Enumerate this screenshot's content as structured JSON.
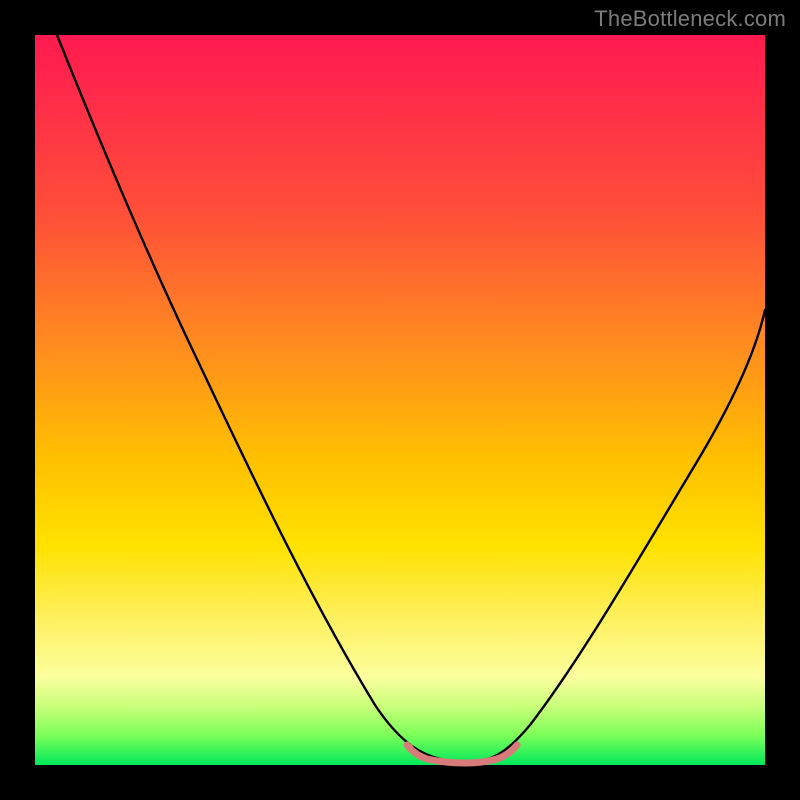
{
  "watermark": "TheBottleneck.com",
  "chart_data": {
    "type": "line",
    "title": "",
    "xlabel": "",
    "ylabel": "",
    "xlim": [
      0,
      100
    ],
    "ylim": [
      0,
      100
    ],
    "grid": false,
    "legend": false,
    "gradient_stops": [
      {
        "pos": 0,
        "color": "#ff1a4f"
      },
      {
        "pos": 25,
        "color": "#ff5038"
      },
      {
        "pos": 50,
        "color": "#ffb010"
      },
      {
        "pos": 75,
        "color": "#fff060"
      },
      {
        "pos": 92,
        "color": "#c8ff7a"
      },
      {
        "pos": 100,
        "color": "#00e85a"
      }
    ],
    "series": [
      {
        "name": "bottleneck-curve",
        "color": "#000000",
        "points": [
          {
            "x": 3,
            "y": 100
          },
          {
            "x": 10,
            "y": 82
          },
          {
            "x": 20,
            "y": 60
          },
          {
            "x": 30,
            "y": 40
          },
          {
            "x": 40,
            "y": 20
          },
          {
            "x": 48,
            "y": 6
          },
          {
            "x": 52,
            "y": 1
          },
          {
            "x": 58,
            "y": 0
          },
          {
            "x": 62,
            "y": 0
          },
          {
            "x": 66,
            "y": 2
          },
          {
            "x": 72,
            "y": 10
          },
          {
            "x": 80,
            "y": 25
          },
          {
            "x": 90,
            "y": 44
          },
          {
            "x": 100,
            "y": 63
          }
        ]
      },
      {
        "name": "trough-marker",
        "color": "#d46a6a",
        "points": [
          {
            "x": 51,
            "y": 2.5
          },
          {
            "x": 53,
            "y": 1.0
          },
          {
            "x": 55,
            "y": 0.3
          },
          {
            "x": 58,
            "y": 0.0
          },
          {
            "x": 61,
            "y": 0.2
          },
          {
            "x": 63,
            "y": 0.8
          },
          {
            "x": 65,
            "y": 2.2
          }
        ]
      }
    ]
  }
}
